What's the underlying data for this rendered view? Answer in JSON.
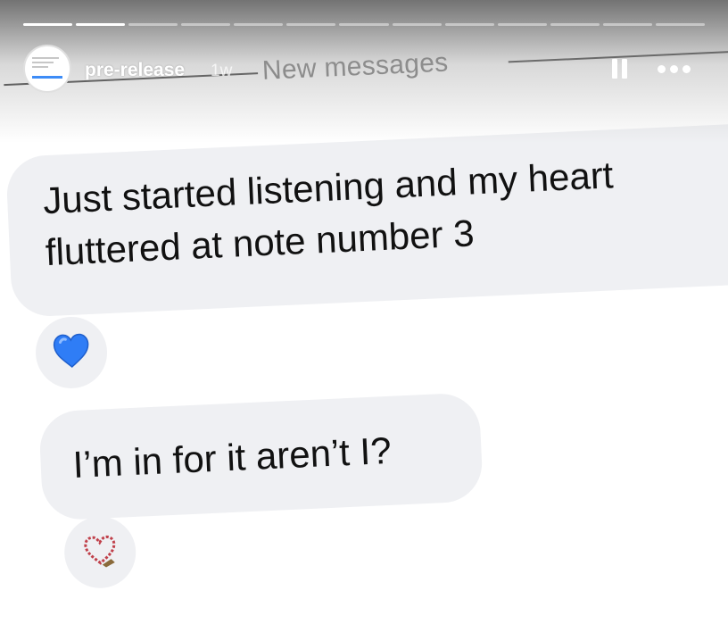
{
  "story": {
    "segments_total": 13,
    "segments_viewed": 2
  },
  "header": {
    "username": "pre-release",
    "time_ago": "1w",
    "avatar_icon": "screenshot-thumbnail-icon",
    "pause_icon": "pause-icon",
    "more_icon": "more-icon"
  },
  "screenshot": {
    "divider_label": "New messages",
    "messages": [
      {
        "line1": "Just started listening and my heart",
        "line2": "fluttered at note number 3",
        "reaction": "💙",
        "reaction_icon": "blue-heart-icon"
      },
      {
        "line1": "I’m in for it aren’t I?",
        "reaction": "🪢",
        "reaction_icon": "heart-outline-icon"
      }
    ]
  },
  "colors": {
    "bubble": "#eff0f3",
    "text": "#111111",
    "heart_blue": "#2f7df6",
    "divider_text": "#777777"
  }
}
